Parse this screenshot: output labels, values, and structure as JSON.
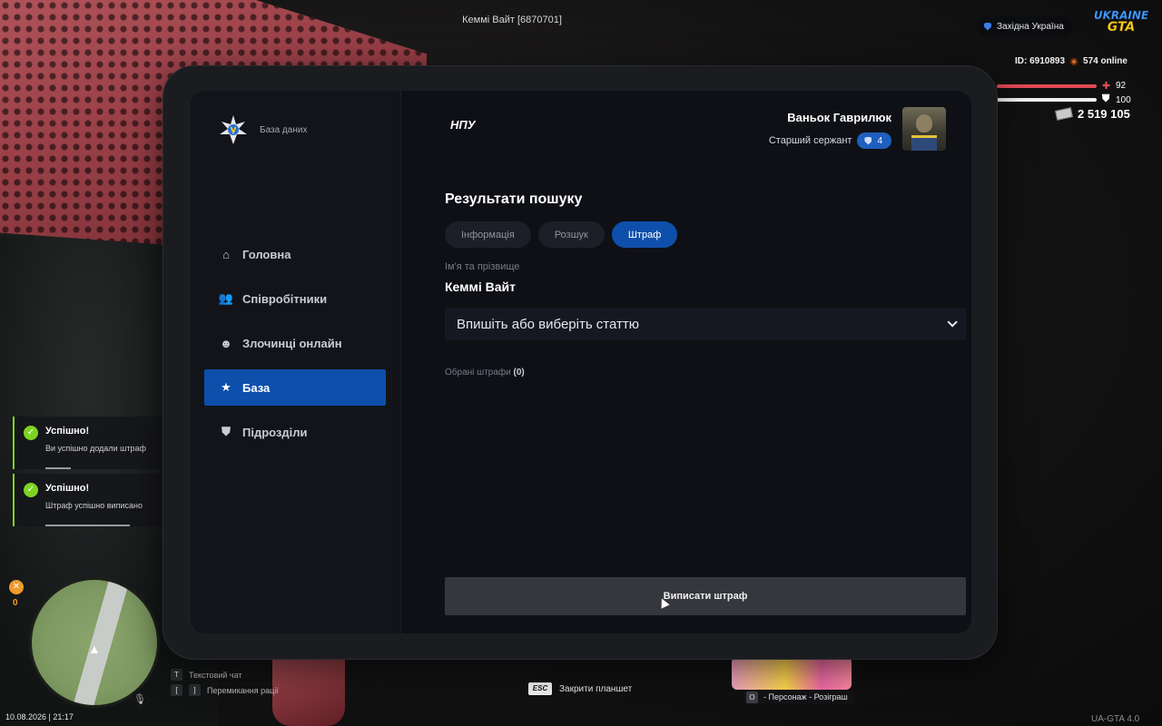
{
  "hud": {
    "player_name": "Кеммі Вайт [6870701]",
    "server_name": "Західна Україна",
    "logo_line1": "UKRAINE",
    "logo_line2": "GTA",
    "player_id": "ID: 6910893",
    "online": "574 online",
    "health": "92",
    "armor": "100",
    "money": "2 519 105",
    "wanted_level": "0",
    "datetime": "10.08.2026 | 21:17",
    "version": "UA-GTA 4.0",
    "colors": {
      "health": "#e14a57",
      "armor": "#f2f2f2",
      "wanted": "#f09a2c"
    }
  },
  "hints": {
    "chat_key": "T",
    "chat_label": "Текстовий чат",
    "radio_key_left": "[",
    "radio_key_right": "]",
    "radio_label": "Перемикання рації",
    "esc_key": "ESC",
    "esc_label": "Закрити планшет",
    "promo_key": "O",
    "promo_label": "- Персонаж - Розіграш"
  },
  "notifications": [
    {
      "title": "Успішно!",
      "message": "Ви успішно додали штраф",
      "progress": 0.15
    },
    {
      "title": "Успішно!",
      "message": "Штраф успішно виписано",
      "progress": 0.5
    }
  ],
  "tablet": {
    "brand_sub": "База даних",
    "brand_main": "НПУ",
    "nav": [
      {
        "label": "Головна",
        "icon": "home-icon",
        "active": false
      },
      {
        "label": "Співробітники",
        "icon": "staff-icon",
        "active": false
      },
      {
        "label": "Злочинці онлайн",
        "icon": "criminal-icon",
        "active": false
      },
      {
        "label": "База",
        "icon": "star-icon",
        "active": true
      },
      {
        "label": "Підрозділи",
        "icon": "shield-icon",
        "active": false
      }
    ],
    "user": {
      "name": "Ваньок Гаврилюк",
      "rank": "Старший сержант",
      "rank_level": "4"
    },
    "section_title": "Результати пошуку",
    "tabs": [
      {
        "label": "Інформація",
        "active": false
      },
      {
        "label": "Розшук",
        "active": false
      },
      {
        "label": "Штраф",
        "active": true
      }
    ],
    "name_label": "Ім'я та прізвище",
    "name_value": "Кеммі Вайт",
    "article_placeholder": "Впишіть або виберіть статтю",
    "selected_fines_label": "Обрані штрафи",
    "selected_fines_count": "(0)",
    "submit_label": "Виписати штраф",
    "accent": "#0e4fab"
  }
}
